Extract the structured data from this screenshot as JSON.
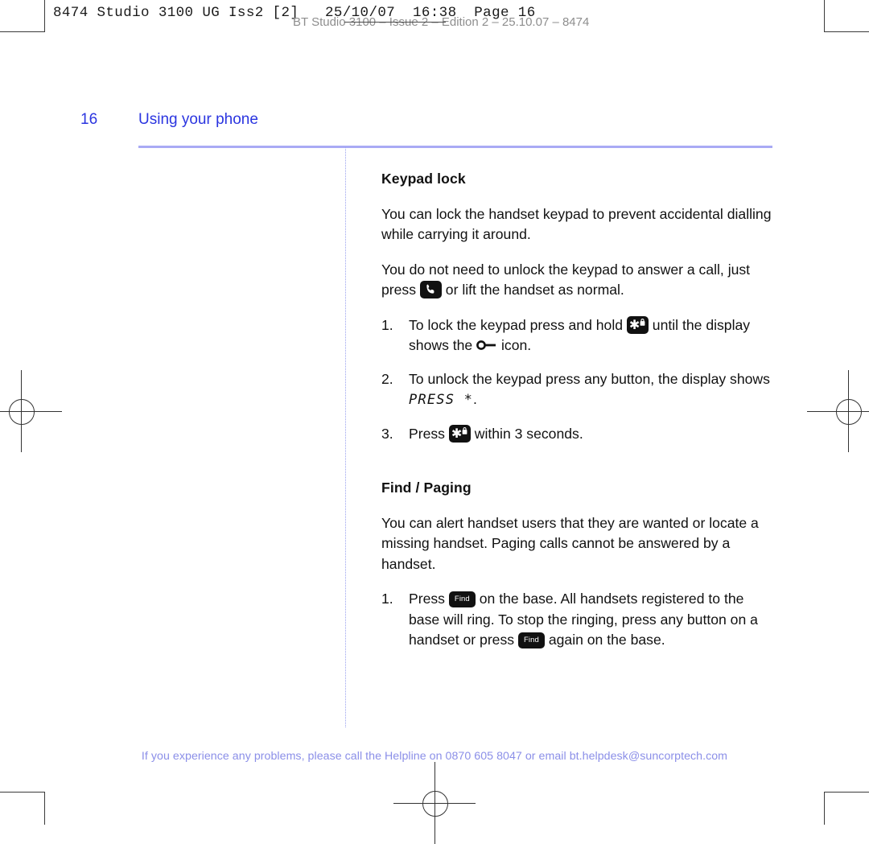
{
  "prepress": {
    "job_slug": "8474 Studio 3100 UG Iss2 [2]   25/10/07  16:38  Page 16",
    "edition_slug": "BT Studio 3100 – Issue 2 – Edition 2 – 25.10.07 – 8474"
  },
  "header": {
    "page_number": "16",
    "section_title": "Using your phone",
    "accent_color": "#2b35e0",
    "rule_color": "#a9aaf5"
  },
  "sections": [
    {
      "heading": "Keypad lock",
      "paragraphs": [
        "You can lock the handset keypad to prevent accidental dialling while carrying it around.",
        "You do not need to unlock the keypad to answer a call, just press "
      ],
      "para2_tail": " or lift the handset as normal.",
      "steps": [
        {
          "num": "1.",
          "pre": "To lock the keypad press and hold ",
          "mid": " until the display shows the ",
          "post": " icon."
        },
        {
          "num": "2.",
          "pre": "To unlock the keypad press any button, the display shows ",
          "lcd": "PRESS *",
          "post": "."
        },
        {
          "num": "3.",
          "pre": "Press ",
          "post": " within 3 seconds."
        }
      ]
    },
    {
      "heading": "Find / Paging",
      "paragraphs": [
        "You can alert handset users that they are wanted or locate a missing handset. Paging calls cannot be answered by a handset."
      ],
      "steps": [
        {
          "num": "1.",
          "pre": "Press ",
          "mid": " on the base. All handsets registered to the base will ring. To stop the ringing, press any button on a handset or press ",
          "post": " again on the base."
        }
      ]
    }
  ],
  "keys": {
    "find_label": "Find",
    "star_glyph": "✱"
  },
  "footer": {
    "note": "If you experience any problems, please call the Helpline on 0870 605 8047 or email bt.helpdesk@suncorptech.com",
    "color": "#8b8fe8"
  }
}
